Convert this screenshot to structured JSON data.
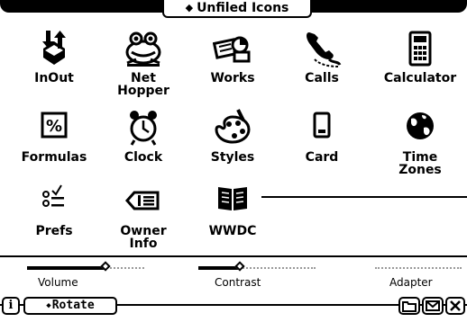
{
  "header": {
    "folder_title": "Unfiled Icons"
  },
  "apps": [
    {
      "label": "InOut",
      "icon": "inout-icon"
    },
    {
      "label": "Net\nHopper",
      "icon": "frog-icon"
    },
    {
      "label": "Works",
      "icon": "works-icon"
    },
    {
      "label": "Calls",
      "icon": "phone-icon"
    },
    {
      "label": "Calculator",
      "icon": "calculator-icon"
    },
    {
      "label": "Formulas",
      "icon": "percent-icon"
    },
    {
      "label": "Clock",
      "icon": "alarm-clock-icon"
    },
    {
      "label": "Styles",
      "icon": "palette-icon"
    },
    {
      "label": "Card",
      "icon": "card-icon"
    },
    {
      "label": "Time\nZones",
      "icon": "globe-icon"
    },
    {
      "label": "Prefs",
      "icon": "prefs-checklist-icon"
    },
    {
      "label": "Owner\nInfo",
      "icon": "owner-info-icon"
    },
    {
      "label": "WWDC",
      "icon": "book-icon"
    }
  ],
  "controls": {
    "volume": {
      "label": "Volume",
      "level": 0.67
    },
    "contrast": {
      "label": "Contrast",
      "level": 0.35
    },
    "adapter": {
      "label": "Adapter"
    }
  },
  "bottom_bar": {
    "info_label": "i",
    "rotate_label": "Rotate",
    "folder_icon": "folder-icon",
    "mail_icon": "envelope-icon",
    "close_icon": "close-icon"
  }
}
